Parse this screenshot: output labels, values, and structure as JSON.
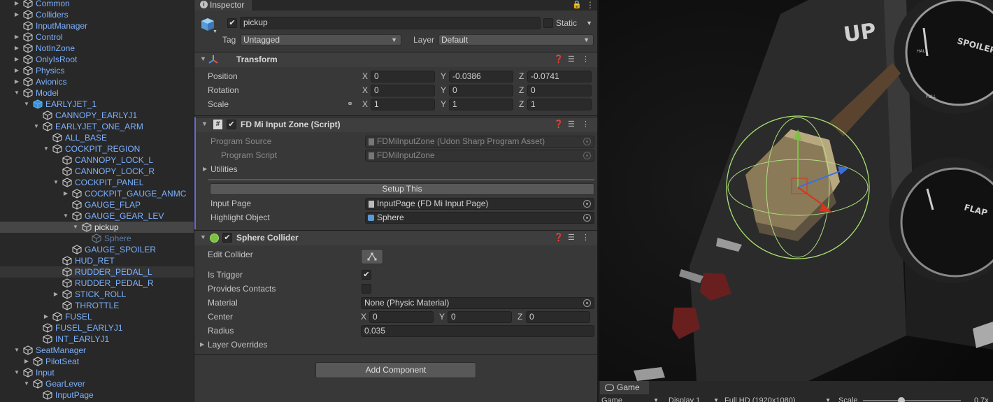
{
  "hierarchy": {
    "items": [
      {
        "label": "Common",
        "depth": 1,
        "arrow": "right"
      },
      {
        "label": "Colliders",
        "depth": 1,
        "arrow": "right"
      },
      {
        "label": "InputManager",
        "depth": 1,
        "arrow": ""
      },
      {
        "label": "Control",
        "depth": 1,
        "arrow": "right"
      },
      {
        "label": "NotInZone",
        "depth": 1,
        "arrow": "right"
      },
      {
        "label": "OnlyIsRoot",
        "depth": 1,
        "arrow": "right"
      },
      {
        "label": "Physics",
        "depth": 1,
        "arrow": "right"
      },
      {
        "label": "Avionics",
        "depth": 1,
        "arrow": "right"
      },
      {
        "label": "Model",
        "depth": 1,
        "arrow": "down"
      },
      {
        "label": "EARLYJET_1",
        "depth": 2,
        "arrow": "down",
        "prefab": true
      },
      {
        "label": "CANNOPY_EARLYJ1",
        "depth": 3,
        "arrow": ""
      },
      {
        "label": "EARLYJET_ONE_ARM",
        "depth": 3,
        "arrow": "down"
      },
      {
        "label": "ALL_BASE",
        "depth": 4,
        "arrow": ""
      },
      {
        "label": "COCKPIT_REGION",
        "depth": 4,
        "arrow": "down"
      },
      {
        "label": "CANNOPY_LOCK_L",
        "depth": 5,
        "arrow": ""
      },
      {
        "label": "CANNOPY_LOCK_R",
        "depth": 5,
        "arrow": ""
      },
      {
        "label": "COCKPIT_PANEL",
        "depth": 5,
        "arrow": "down"
      },
      {
        "label": "COCKPIT_GAUGE_ANMC",
        "depth": 6,
        "arrow": "right"
      },
      {
        "label": "GAUGE_FLAP",
        "depth": 6,
        "arrow": ""
      },
      {
        "label": "GAUGE_GEAR_LEV",
        "depth": 6,
        "arrow": "down"
      },
      {
        "label": "pickup",
        "depth": 7,
        "arrow": "down",
        "selected": true
      },
      {
        "label": "Sphere",
        "depth": 8,
        "arrow": "",
        "dim": true
      },
      {
        "label": "GAUGE_SPOILER",
        "depth": 6,
        "arrow": ""
      },
      {
        "label": "HUD_RET",
        "depth": 5,
        "arrow": ""
      },
      {
        "label": "RUDDER_PEDAL_L",
        "depth": 5,
        "arrow": "",
        "hover": true
      },
      {
        "label": "RUDDER_PEDAL_R",
        "depth": 5,
        "arrow": ""
      },
      {
        "label": "STICK_ROLL",
        "depth": 5,
        "arrow": "right"
      },
      {
        "label": "THROTTLE",
        "depth": 5,
        "arrow": ""
      },
      {
        "label": "FUSEL",
        "depth": 4,
        "arrow": "right"
      },
      {
        "label": "FUSEL_EARLYJ1",
        "depth": 3,
        "arrow": ""
      },
      {
        "label": "INT_EARLYJ1",
        "depth": 3,
        "arrow": ""
      },
      {
        "label": "SeatManager",
        "depth": 1,
        "arrow": "down"
      },
      {
        "label": "PilotSeat",
        "depth": 2,
        "arrow": "right"
      },
      {
        "label": "Input",
        "depth": 1,
        "arrow": "down"
      },
      {
        "label": "GearLever",
        "depth": 2,
        "arrow": "down"
      },
      {
        "label": "InputPage",
        "depth": 3,
        "arrow": ""
      }
    ]
  },
  "inspector": {
    "tab_label": "Inspector",
    "object_name": "pickup",
    "static_label": "Static",
    "tag_label": "Tag",
    "tag_value": "Untagged",
    "layer_label": "Layer",
    "layer_value": "Default",
    "transform": {
      "title": "Transform",
      "position_label": "Position",
      "rotation_label": "Rotation",
      "scale_label": "Scale",
      "position": {
        "x": "0",
        "y": "-0.0386",
        "z": "-0.0741"
      },
      "rotation": {
        "x": "0",
        "y": "0",
        "z": "0"
      },
      "scale": {
        "x": "1",
        "y": "1",
        "z": "1"
      }
    },
    "script": {
      "title": "FD Mi Input Zone (Script)",
      "program_source_label": "Program Source",
      "program_source_value": "FDMiInputZone (Udon Sharp Program Asset)",
      "program_script_label": "Program Script",
      "program_script_value": "FDMiInputZone",
      "utilities_label": "Utilities",
      "setup_button": "Setup This",
      "input_page_label": "Input Page",
      "input_page_value": "InputPage (FD Mi Input Page)",
      "highlight_label": "Highlight Object",
      "highlight_value": "Sphere"
    },
    "collider": {
      "title": "Sphere Collider",
      "edit_collider_label": "Edit Collider",
      "is_trigger_label": "Is Trigger",
      "provides_contacts_label": "Provides Contacts",
      "material_label": "Material",
      "material_value": "None (Physic Material)",
      "center_label": "Center",
      "center": {
        "x": "0",
        "y": "0",
        "z": "0"
      },
      "radius_label": "Radius",
      "radius_value": "0.035",
      "layer_overrides_label": "Layer Overrides"
    },
    "add_component": "Add Component",
    "axis": {
      "x": "X",
      "y": "Y",
      "z": "Z"
    }
  },
  "scene": {
    "panel_text_1": "UP",
    "panel_text_2": "SPOILER",
    "panel_text_3": "FLAP",
    "gauge_half": "HALF",
    "gauge_full": "FULL"
  },
  "gamebar": {
    "tab_label": "Game",
    "display_mode": "Game",
    "display": "Display 1",
    "resolution": "Full HD (1920x1080)",
    "scale_label": "Scale",
    "scale_value": "0.7x"
  },
  "colors": {
    "hierarchy_text": "#7cb1ff",
    "selection": "#464646",
    "panel_bg": "#383838"
  }
}
